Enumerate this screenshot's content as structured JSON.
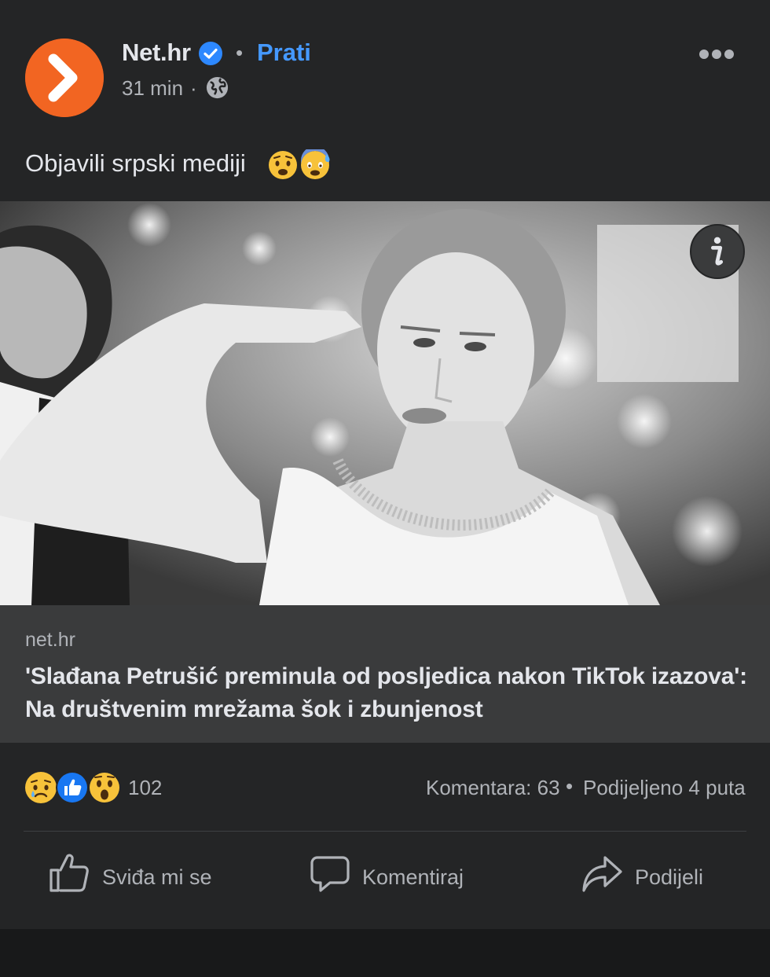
{
  "header": {
    "page_name": "Net.hr",
    "verified": true,
    "separator": "•",
    "follow_label": "Prati",
    "time": "31 min",
    "time_separator": "·",
    "privacy_icon": "globe-icon",
    "more_icon": "more-dots-icon"
  },
  "post": {
    "caption": "Objavili srpski mediji",
    "caption_emojis": [
      "worried-face",
      "anxious-sweat-face"
    ],
    "photo_icon": "info-icon"
  },
  "link_preview": {
    "domain": "net.hr",
    "title": "'Slađana Petrušić preminula od posljedica nakon TikTok izazova': Na društvenim mrežama šok i zbunjenost"
  },
  "stats": {
    "reactions": [
      "sad",
      "like",
      "wow"
    ],
    "reaction_count": "102",
    "comments": "Komentara: 63",
    "separator": "•",
    "shares": "Podijeljeno 4 puta"
  },
  "actions": {
    "like_label": "Sviđa mi se",
    "comment_label": "Komentiraj",
    "share_label": "Podijeli"
  },
  "colors": {
    "background": "#242526",
    "accent": "#4599ff",
    "brand": "#f26522",
    "secondary_text": "#b0b3b8"
  }
}
